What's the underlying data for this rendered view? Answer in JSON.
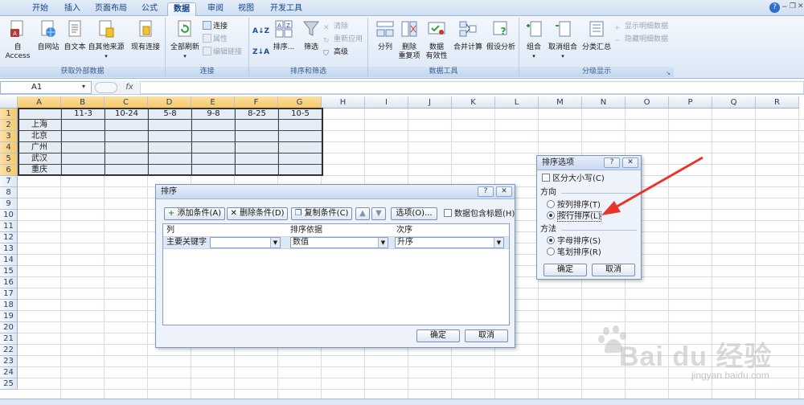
{
  "tabs": [
    "开始",
    "插入",
    "页面布局",
    "公式",
    "数据",
    "审阅",
    "视图",
    "开发工具"
  ],
  "active_tab": "数据",
  "ribbon": {
    "groups": [
      {
        "title": "获取外部数据"
      },
      {
        "title": "连接"
      },
      {
        "title": "排序和筛选"
      },
      {
        "title": "数据工具"
      },
      {
        "title": "分级显示"
      }
    ],
    "buttons": {
      "access": "自 Access",
      "web": "自网站",
      "text": "自文本",
      "other": "自其他来源",
      "existing": "现有连接",
      "refresh": "全部刷新",
      "connections": "连接",
      "properties": "属性",
      "edit_links": "编辑链接",
      "sort_az": "A↓Z",
      "sort": "排序...",
      "filter": "筛选",
      "clear": "清除",
      "reapply": "重新应用",
      "advanced": "高级",
      "split": "分列",
      "remove_dup_1": "删除",
      "remove_dup_2": "重复项",
      "validation_1": "数据",
      "validation_2": "有效性",
      "consolidate": "合并计算",
      "whatif": "假设分析",
      "group": "组合",
      "ungroup": "取消组合",
      "subtotal": "分类汇总",
      "show_detail": "显示明细数据",
      "hide_detail": "隐藏明细数据"
    }
  },
  "formula_bar": {
    "name_box": "A1",
    "fx": "fx"
  },
  "columns": [
    "A",
    "B",
    "C",
    "D",
    "E",
    "F",
    "G",
    "H",
    "I",
    "J",
    "K",
    "L",
    "M",
    "N",
    "O",
    "P",
    "Q",
    "R"
  ],
  "rows": [
    "1",
    "2",
    "3",
    "4",
    "5",
    "6",
    "7",
    "8",
    "9",
    "10",
    "11",
    "12",
    "13",
    "14",
    "15",
    "16",
    "17",
    "18",
    "19",
    "20",
    "21",
    "22",
    "23",
    "24",
    "25"
  ],
  "sheet": {
    "header_row": [
      "11-3",
      "10-24",
      "5-8",
      "9-8",
      "8-25",
      "10-5"
    ],
    "cities": [
      "上海",
      "北京",
      "广州",
      "武汉",
      "重庆"
    ]
  },
  "sort_dialog": {
    "title": "排序",
    "help": "?",
    "close": "✕",
    "add": "添加条件(A)",
    "delete": "删除条件(D)",
    "copy": "复制条件(C)",
    "options": "选项(O)...",
    "has_header": "数据包含标题(H)",
    "col_header": "列",
    "basis_header": "排序依据",
    "order_header": "次序",
    "main_key": "主要关键字",
    "key_value": "",
    "basis_value": "数值",
    "order_value": "升序",
    "ok": "确定",
    "cancel": "取消"
  },
  "options_dialog": {
    "title": "排序选项",
    "help": "?",
    "close": "✕",
    "case": "区分大小写(C)",
    "direction": "方向",
    "by_col": "按列排序(T)",
    "by_row": "按行排序(L)",
    "method": "方法",
    "alpha": "字母排序(S)",
    "stroke": "笔划排序(R)",
    "ok": "确定",
    "cancel": "取消"
  },
  "watermark": {
    "brand": "Bai du 经验",
    "url": "jingyan.baidu.com"
  },
  "colors": {
    "arrow": "#e8352b",
    "ribbon_blue": "#15428b"
  }
}
